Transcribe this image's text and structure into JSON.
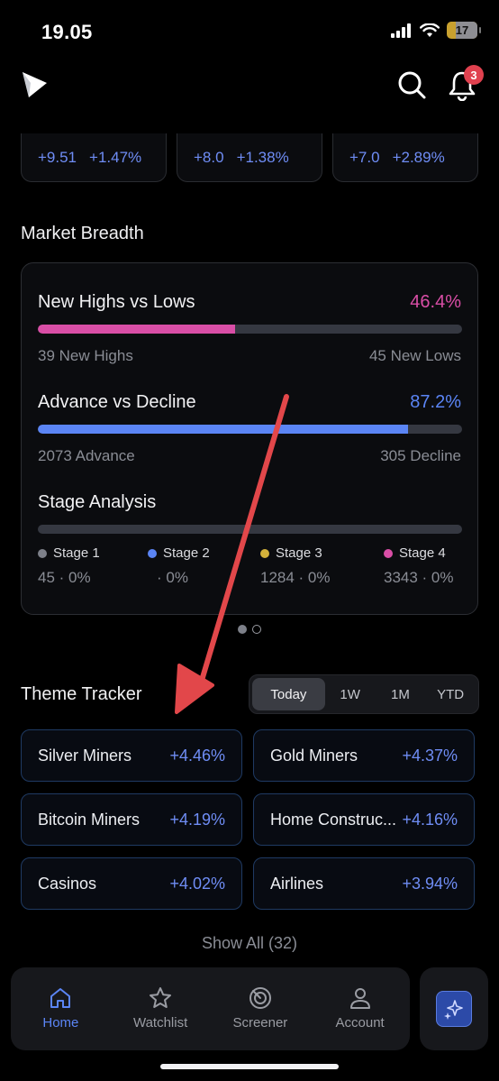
{
  "status": {
    "time": "19.05",
    "battery": "17"
  },
  "header": {
    "notification_count": "3"
  },
  "indices": [
    {
      "change": "+9.51",
      "pct": "+1.47%"
    },
    {
      "change": "+8.0",
      "pct": "+1.38%"
    },
    {
      "change": "+7.0",
      "pct": "+2.89%"
    }
  ],
  "market_breadth": {
    "title": "Market Breadth",
    "highs_lows": {
      "label": "New Highs vs Lows",
      "pct": "46.4%",
      "fraction": 0.464,
      "left": "39 New Highs",
      "right": "45 New Lows",
      "color": "#d94ea6"
    },
    "adv_dec": {
      "label": "Advance vs Decline",
      "pct": "87.2%",
      "fraction": 0.872,
      "left": "2073 Advance",
      "right": "305 Decline",
      "color": "#5b85f5"
    },
    "stage": {
      "label": "Stage Analysis",
      "stages": [
        {
          "name": "Stage 1",
          "value": "45 · 0%",
          "color": "#7d8089"
        },
        {
          "name": "Stage 2",
          "value": "· 0%",
          "color": "#5b85f5"
        },
        {
          "name": "Stage 3",
          "value": "1284 · 0%",
          "color": "#d4b23b"
        },
        {
          "name": "Stage 4",
          "value": "3343 · 0%",
          "color": "#d94ea6"
        }
      ]
    }
  },
  "theme_tracker": {
    "title": "Theme Tracker",
    "periods": [
      "Today",
      "1W",
      "1M",
      "YTD"
    ],
    "active_period": "Today",
    "themes": [
      {
        "name": "Silver Miners",
        "change": "+4.46%"
      },
      {
        "name": "Gold Miners",
        "change": "+4.37%"
      },
      {
        "name": "Bitcoin Miners",
        "change": "+4.19%"
      },
      {
        "name": "Home Construc...",
        "change": "+4.16%"
      },
      {
        "name": "Casinos",
        "change": "+4.02%"
      },
      {
        "name": "Airlines",
        "change": "+3.94%"
      }
    ],
    "show_all": "Show All (32)"
  },
  "tabs": [
    {
      "label": "Home",
      "icon": "home-icon",
      "active": true
    },
    {
      "label": "Watchlist",
      "icon": "star-icon",
      "active": false
    },
    {
      "label": "Screener",
      "icon": "radar-icon",
      "active": false
    },
    {
      "label": "Account",
      "icon": "person-icon",
      "active": false
    }
  ],
  "colors": {
    "accent": "#5b85f5",
    "pink": "#d94ea6",
    "annotation_arrow": "#e2474a"
  }
}
